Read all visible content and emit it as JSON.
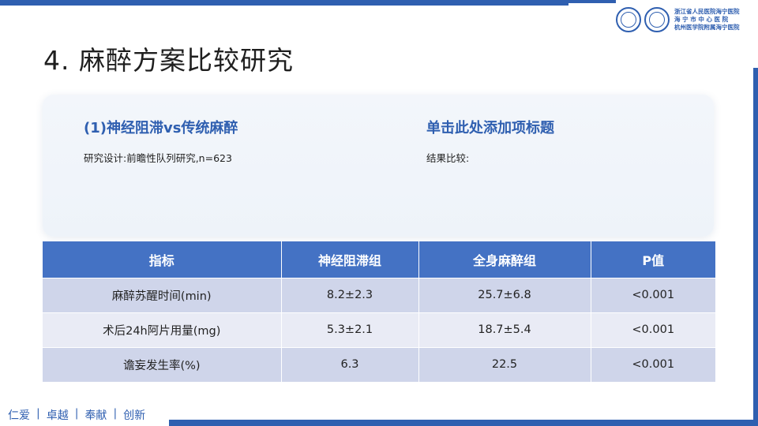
{
  "header": {
    "title": "4. 麻醉方案比较研究",
    "logo_lines": [
      "浙江省人民医院海宁医院",
      "海 宁 市 中 心 医 院",
      "杭州医学院附属海宁医院"
    ]
  },
  "card": {
    "left_title": "(1)神经阻滞vs传统麻醉",
    "left_text": "研究设计:前瞻性队列研究,n=623",
    "right_title": "单击此处添加项标题",
    "right_text": "结果比较:"
  },
  "table": {
    "headers": [
      "指标",
      "神经阻滞组",
      "全身麻醉组",
      "P值"
    ],
    "rows": [
      [
        "麻醉苏醒时间(min)",
        "8.2±2.3",
        "25.7±6.8",
        "<0.001"
      ],
      [
        "术后24h阿片用量(mg)",
        "5.3±2.1",
        "18.7±5.4",
        "<0.001"
      ],
      [
        "谵妄发生率(%)",
        "6.3",
        "22.5",
        "<0.001"
      ]
    ]
  },
  "footer": {
    "values": [
      "仁爱",
      "卓越",
      "奉献",
      "创新"
    ],
    "separator": "|"
  },
  "colors": {
    "brand": "#2f5fb0",
    "header_bg": "#4472c4",
    "row_dark": "#cfd5ea",
    "row_light": "#e9ebf5"
  }
}
